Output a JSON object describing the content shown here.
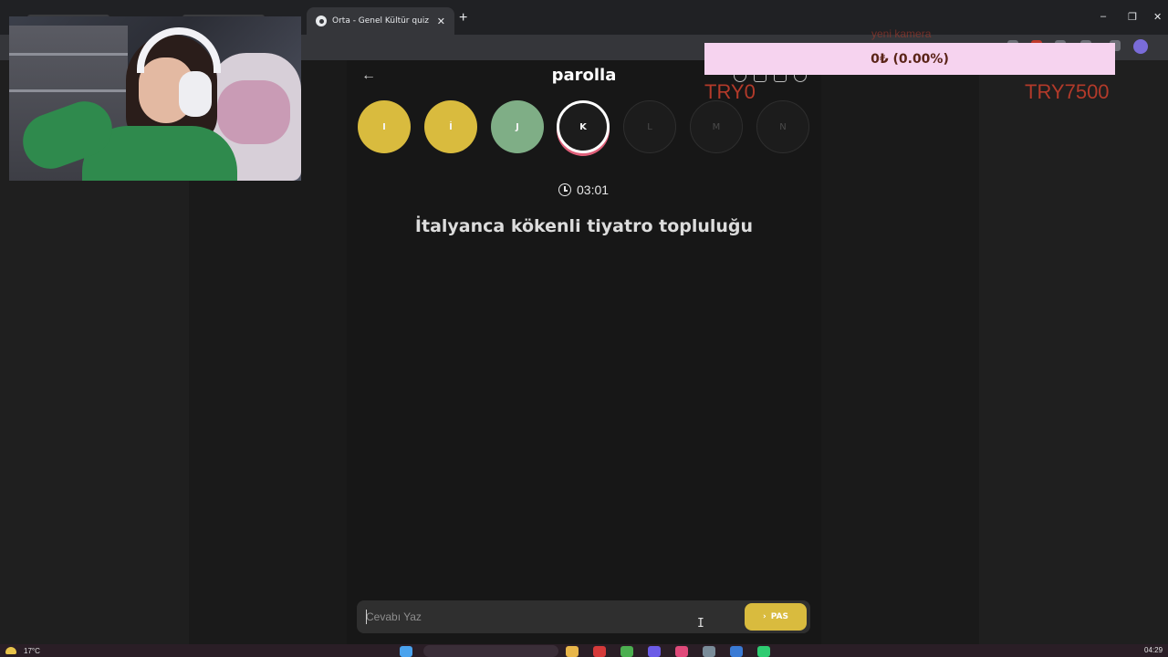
{
  "browser": {
    "active_tab_title": "Orta - Genel Kültür quiz - parolla",
    "tab_close_glyph": "✕",
    "new_tab_glyph": "+",
    "window_controls": [
      "–",
      "❐",
      "✕"
    ]
  },
  "game": {
    "title": "parolla",
    "back_glyph": "←",
    "letters": [
      {
        "letter": "I",
        "state": "correct-yellow"
      },
      {
        "letter": "İ",
        "state": "correct-yellow"
      },
      {
        "letter": "J",
        "state": "correct-green"
      },
      {
        "letter": "K",
        "state": "current"
      },
      {
        "letter": "L",
        "state": "pending"
      },
      {
        "letter": "M",
        "state": "pending"
      },
      {
        "letter": "N",
        "state": "pending"
      }
    ],
    "timer": "03:01",
    "question": "İtalyanca kökenli tiyatro topluluğu",
    "answer_placeholder": "Cevabı Yaz",
    "pas_label": "PAS",
    "pas_glyph": "›"
  },
  "overlays": {
    "faded_label": "yeni kamera",
    "donation": "0₺ (0.00%)",
    "try_left": "TRY0",
    "try_right": "TRY7500"
  },
  "taskbar": {
    "temperature": "17°C",
    "time": "04:29"
  },
  "colors": {
    "yellow": "#d9bb3e",
    "green": "#7fae86",
    "accent_pink": "#e0607a",
    "overlay_red": "#b33a2a"
  }
}
